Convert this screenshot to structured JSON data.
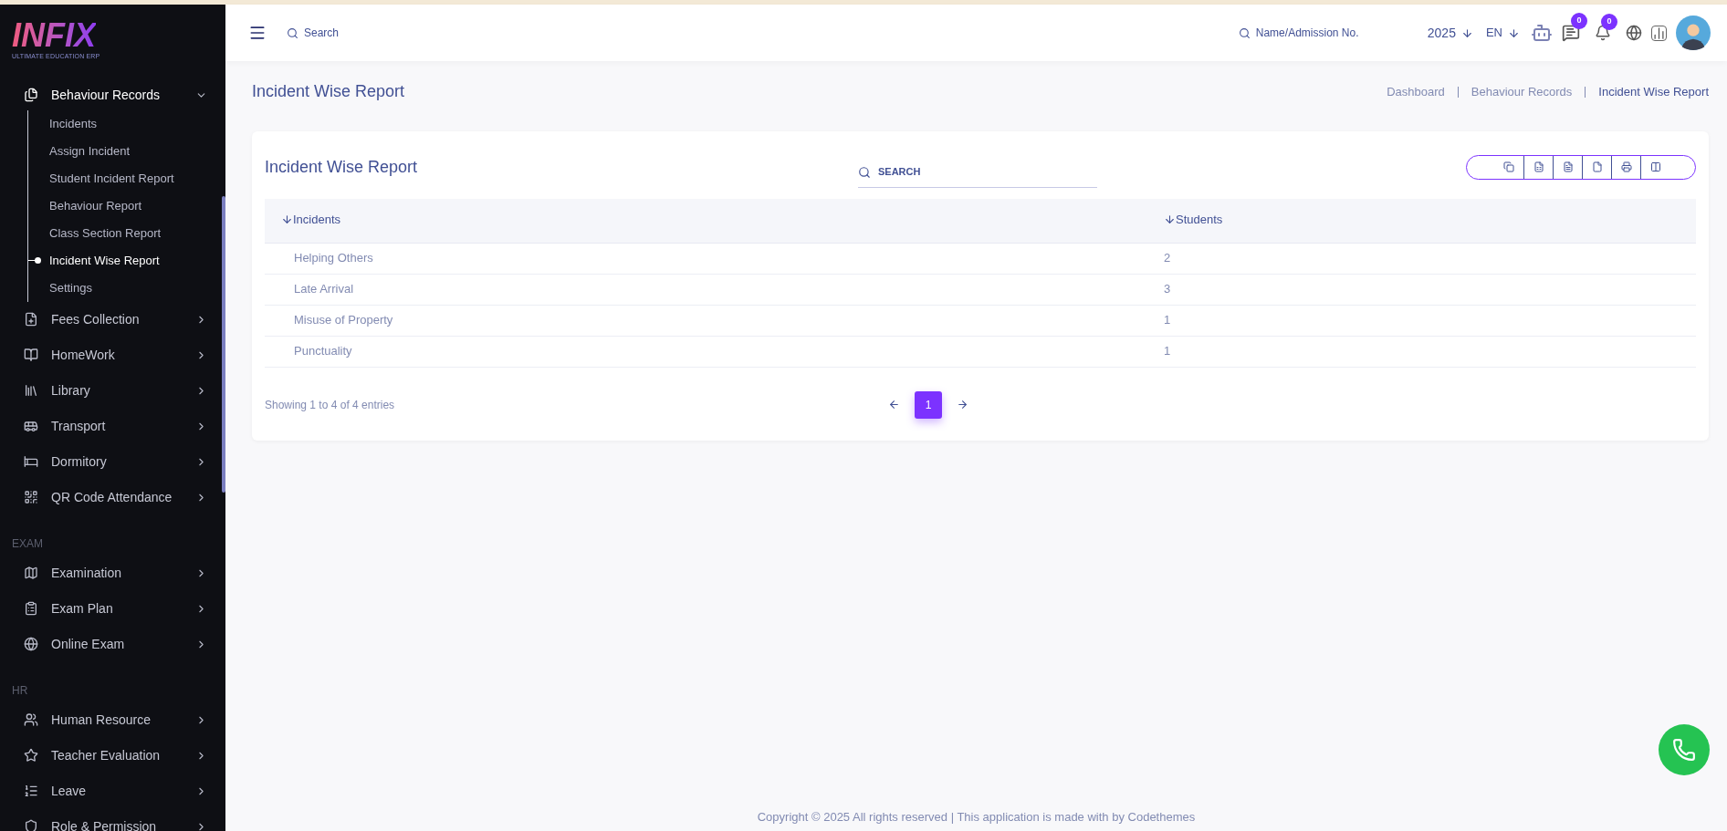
{
  "sidebar": {
    "logo": {
      "name": "INFIX",
      "tagline": "ULTIMATE EDUCATION ERP"
    },
    "groups": [
      {
        "items": [
          {
            "label": "Behaviour Records",
            "expanded": true,
            "children": [
              {
                "label": "Incidents",
                "selected": false
              },
              {
                "label": "Assign Incident",
                "selected": false
              },
              {
                "label": "Student Incident Report",
                "selected": false
              },
              {
                "label": "Behaviour Report",
                "selected": false
              },
              {
                "label": "Class Section Report",
                "selected": false
              },
              {
                "label": "Incident Wise Report",
                "selected": true
              },
              {
                "label": "Settings",
                "selected": false
              }
            ]
          },
          {
            "label": "Fees Collection",
            "expanded": false
          },
          {
            "label": "HomeWork",
            "expanded": false
          },
          {
            "label": "Library",
            "expanded": false
          },
          {
            "label": "Transport",
            "expanded": false
          },
          {
            "label": "Dormitory",
            "expanded": false
          },
          {
            "label": "QR Code Attendance",
            "expanded": false
          }
        ]
      },
      {
        "heading": "EXAM",
        "items": [
          {
            "label": "Examination",
            "expanded": false
          },
          {
            "label": "Exam Plan",
            "expanded": false
          },
          {
            "label": "Online Exam",
            "expanded": false
          }
        ]
      },
      {
        "heading": "HR",
        "items": [
          {
            "label": "Human Resource",
            "expanded": false
          },
          {
            "label": "Teacher Evaluation",
            "expanded": false
          },
          {
            "label": "Leave",
            "expanded": false
          },
          {
            "label": "Role & Permission",
            "expanded": false
          }
        ]
      }
    ]
  },
  "header": {
    "search": {
      "placeholder": "Search"
    },
    "student_search": {
      "placeholder": "Name/Admission No."
    },
    "year": "2025",
    "language": "EN",
    "messages_badge": "0",
    "notifications_badge": "0"
  },
  "page_title": "Incident Wise Report",
  "breadcrumb": [
    {
      "label": "Dashboard",
      "selected": false
    },
    {
      "label": "Behaviour Records",
      "selected": false
    },
    {
      "label": "Incident Wise Report",
      "selected": true
    }
  ],
  "card": {
    "title": "Incident Wise Report",
    "search": {
      "placeholder": "SEARCH"
    },
    "table": {
      "columns": [
        "Incidents",
        "Students"
      ],
      "rows": [
        [
          "Helping Others",
          "2"
        ],
        [
          "Late Arrival",
          "3"
        ],
        [
          "Misuse of Property",
          "1"
        ],
        [
          "Punctuality",
          "1"
        ]
      ]
    },
    "info": "Showing 1 to 4 of 4 entries",
    "pages": [
      {
        "label": "1",
        "selected": true
      }
    ]
  },
  "footer": "Copyright © 2025 All rights reserved | This application is made with by Codethemes"
}
